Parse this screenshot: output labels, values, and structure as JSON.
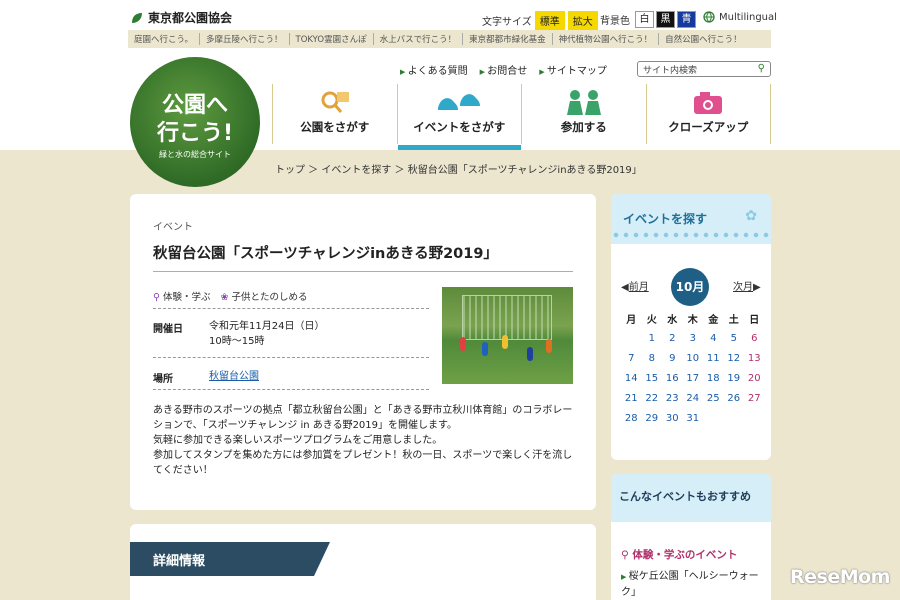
{
  "header": {
    "org": "東京都公園協会",
    "textsize_label": "文字サイズ",
    "textsize_options": [
      "標準",
      "拡大"
    ],
    "bgcolor_label": "背景色",
    "bgcolor_options": [
      "白",
      "黒",
      "青"
    ],
    "multilingual": "Multilingual"
  },
  "linkbar": [
    "庭園へ行こう。",
    "多摩丘陵へ行こう！",
    "TOKYO霊園さんぽ",
    "水上バスで行こう！",
    "東京都都市緑化基金",
    "神代植物公園へ行こう！",
    "自然公園へ行こう！"
  ],
  "logo": {
    "line1": "公園へ",
    "line2": "行こう!",
    "sub": "緑と水の総合サイト"
  },
  "utility": [
    "よくある質問",
    "お問合せ",
    "サイトマップ"
  ],
  "search": {
    "placeholder": "サイト内検索"
  },
  "gnav": [
    {
      "label": "公園をさがす",
      "icon": "magnifier-map-icon"
    },
    {
      "label": "イベントをさがす",
      "icon": "shoes-icon"
    },
    {
      "label": "参加する",
      "icon": "people-icon"
    },
    {
      "label": "クローズアップ",
      "icon": "camera-icon"
    }
  ],
  "breadcrumb": "トップ ＞ イベントを探す ＞ 秋留台公園「スポーツチャレンジinあきる野2019」",
  "event": {
    "category": "イベント",
    "title": "秋留台公園「スポーツチャレンジinあきる野2019」",
    "tags": [
      "体験・学ぶ",
      "子供とたのしめる"
    ],
    "date_label": "開催日",
    "date_value": "令和元年11月24日（日）",
    "time_value": "10時〜15時",
    "place_label": "場所",
    "place_value": "秋留台公園",
    "desc": [
      "あきる野市のスポーツの拠点「都立秋留台公園」と「あきる野市立秋川体育館」のコラボレーションで、「スポーツチャレンジ in あきる野2019」を開催します。",
      "気軽に参加できる楽しいスポーツプログラムをご用意しました。",
      "参加してスタンプを集めた方には参加賞をプレゼント！秋の一日、スポーツで楽しく汗を流してください！"
    ]
  },
  "detail": {
    "heading": "詳細情報"
  },
  "sidebar": {
    "events_title": "イベントを探す",
    "prev": "前月",
    "next": "次月",
    "month": "10月",
    "weekdays": [
      "月",
      "火",
      "水",
      "木",
      "金",
      "土",
      "日"
    ],
    "weeks": [
      [
        "",
        "1",
        "2",
        "3",
        "4",
        "5",
        "6"
      ],
      [
        "7",
        "8",
        "9",
        "10",
        "11",
        "12",
        "13"
      ],
      [
        "14",
        "15",
        "16",
        "17",
        "18",
        "19",
        "20"
      ],
      [
        "21",
        "22",
        "23",
        "24",
        "25",
        "26",
        "27"
      ],
      [
        "28",
        "29",
        "30",
        "31",
        "",
        "",
        ""
      ]
    ],
    "recommend_title": "こんなイベントもおすすめ",
    "recommend_sub": "体験・学ぶのイベント",
    "recommend_link": "桜ケ丘公園「ヘルシーウォーク」"
  },
  "watermark": "ReseMom"
}
